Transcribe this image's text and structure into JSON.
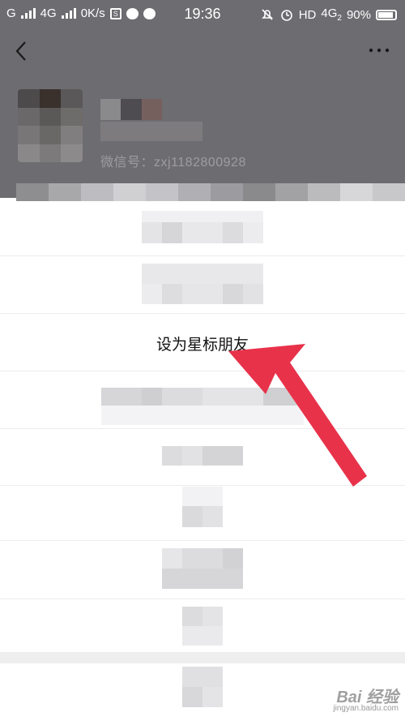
{
  "status_bar": {
    "carrier_left": "G",
    "network_left": "4G",
    "speed": "0K/s",
    "s_badge": "S",
    "time": "19:36",
    "hd": "HD",
    "network_right": "4G",
    "network_right_sub": "2",
    "battery_percent": "90%"
  },
  "profile": {
    "wechat_id": "微信号：zxj1182800928"
  },
  "list": {
    "star_friend_label": "设为星标朋友"
  },
  "watermark": {
    "logo": "Bai 经验",
    "url": "jingyan.baidu.com"
  },
  "colors": {
    "arrow": "#e8324a",
    "overlay": "#6d6c70"
  }
}
